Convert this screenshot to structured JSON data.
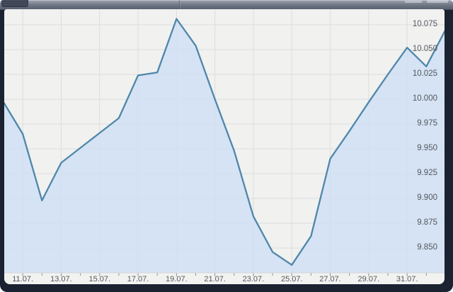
{
  "chart_data": {
    "type": "area",
    "title": "",
    "xlabel": "",
    "ylabel": "",
    "y_axis_side": "right",
    "grid": true,
    "legend": false,
    "x": [
      "10.07.",
      "11.07.",
      "12.07.",
      "13.07.",
      "14.07.",
      "15.07.",
      "16.07.",
      "17.07.",
      "18.07.",
      "19.07.",
      "20.07.",
      "21.07.",
      "22.07.",
      "23.07.",
      "24.07.",
      "25.07.",
      "26.07.",
      "27.07.",
      "28.07.",
      "29.07.",
      "30.07.",
      "31.07.",
      "01.08.",
      "02.08."
    ],
    "values": [
      9.997,
      9.965,
      9.898,
      9.936,
      9.951,
      9.966,
      9.981,
      10.024,
      10.027,
      10.081,
      10.054,
      10.0,
      9.948,
      9.882,
      9.846,
      9.833,
      9.862,
      9.94,
      9.968,
      9.997,
      10.025,
      10.052,
      10.033,
      10.07
    ],
    "x_axis_tick_labels": [
      "11.07.",
      "13.07.",
      "15.07.",
      "17.07.",
      "19.07.",
      "21.07.",
      "23.07.",
      "25.07.",
      "27.07.",
      "29.07.",
      "31.07."
    ],
    "y_tick_labels": [
      "10.075",
      "10.050",
      "10.025",
      "10.000",
      "9.975",
      "9.950",
      "9.925",
      "9.900",
      "9.875",
      "9.850"
    ],
    "y_tick_values": [
      10.075,
      10.05,
      10.025,
      10.0,
      9.975,
      9.95,
      9.925,
      9.9,
      9.875,
      9.85
    ],
    "ylim": [
      9.825,
      10.091
    ],
    "colors": {
      "line": "#4e87aa",
      "fill": "#cedff4",
      "plot_bg": "#f1f1f0",
      "axis_bg": "#f2f2f1",
      "grid": "#dcddde",
      "tick": "#8d9298",
      "label": "#55595f",
      "frame": "#1b2231",
      "toolbar": "#6f7684"
    }
  }
}
